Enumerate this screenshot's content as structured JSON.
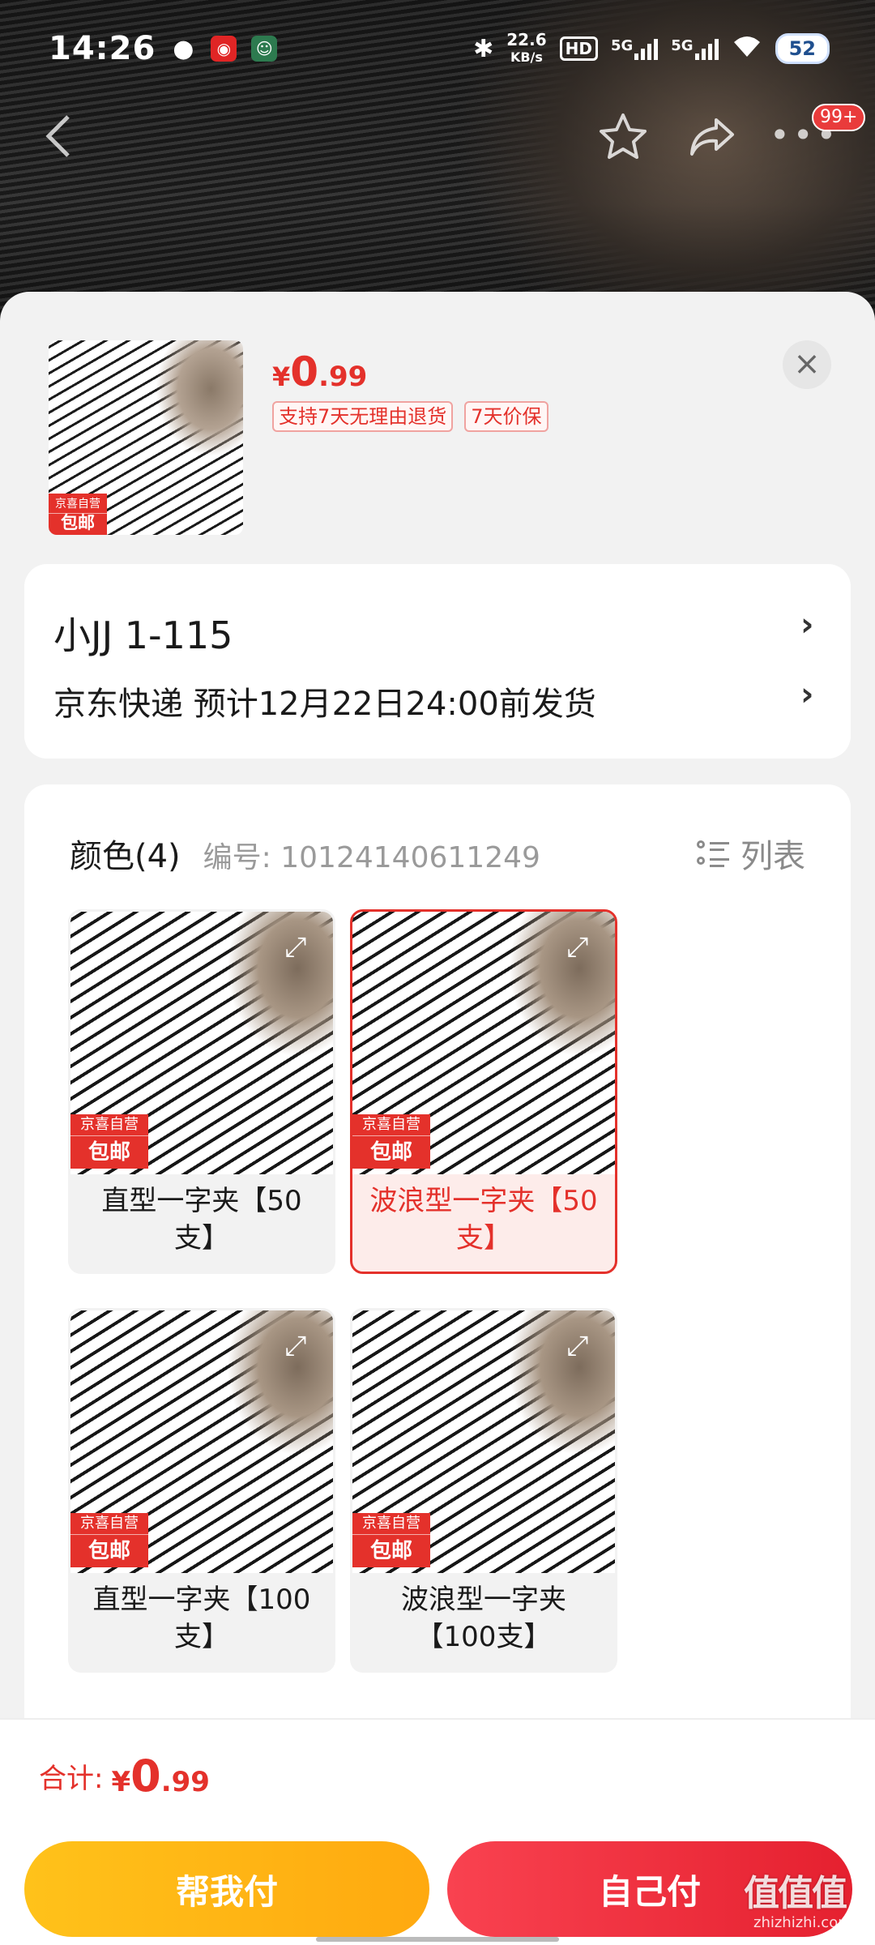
{
  "status_bar": {
    "time": "14:26",
    "net_speed_value": "22.6",
    "net_speed_unit": "KB/s",
    "hd_label": "HD",
    "signal1_label": "5G",
    "signal2_label": "5G",
    "battery": "52"
  },
  "header": {
    "back_icon": "chevron-left-icon",
    "favorite_icon": "star-icon",
    "share_icon": "share-icon",
    "more_icon": "more-icon",
    "more_badge": "99+"
  },
  "summary": {
    "thumb_badge_line1": "京喜自营",
    "thumb_badge_line2": "包邮",
    "price_currency": "¥",
    "price_integer": "0",
    "price_decimal": ".99",
    "tags": [
      "支持7天无理由退货",
      "7天价保"
    ]
  },
  "address": {
    "recipient": "小JJ  1-115",
    "delivery": "京东快递 预计12月22日24:00前发货"
  },
  "spec": {
    "title": "颜色(4)",
    "code": "编号: 10124140611249",
    "list_label": "列表",
    "options": [
      {
        "label": "直型一字夹【50支】",
        "selected": false,
        "badge_line1": "京喜自营",
        "badge_line2": "包邮"
      },
      {
        "label": "波浪型一字夹【50支】",
        "selected": true,
        "badge_line1": "京喜自营",
        "badge_line2": "包邮"
      },
      {
        "label": "直型一字夹【100支】",
        "selected": false,
        "badge_line1": "京喜自营",
        "badge_line2": "包邮"
      },
      {
        "label": "波浪型一字夹【100支】",
        "selected": false,
        "badge_line1": "京喜自营",
        "badge_line2": "包邮"
      }
    ]
  },
  "footer": {
    "total_label": "合计:",
    "total_currency": "¥",
    "total_integer": "0",
    "total_decimal": ".99",
    "help_pay_label": "帮我付",
    "self_pay_label": "自己付"
  },
  "watermark": {
    "text": "值值值",
    "domain": "zhizhizhi.com"
  },
  "colors": {
    "accent": "#e4312b",
    "help_button": "#ffb514",
    "self_button": "#ef2f3e"
  }
}
